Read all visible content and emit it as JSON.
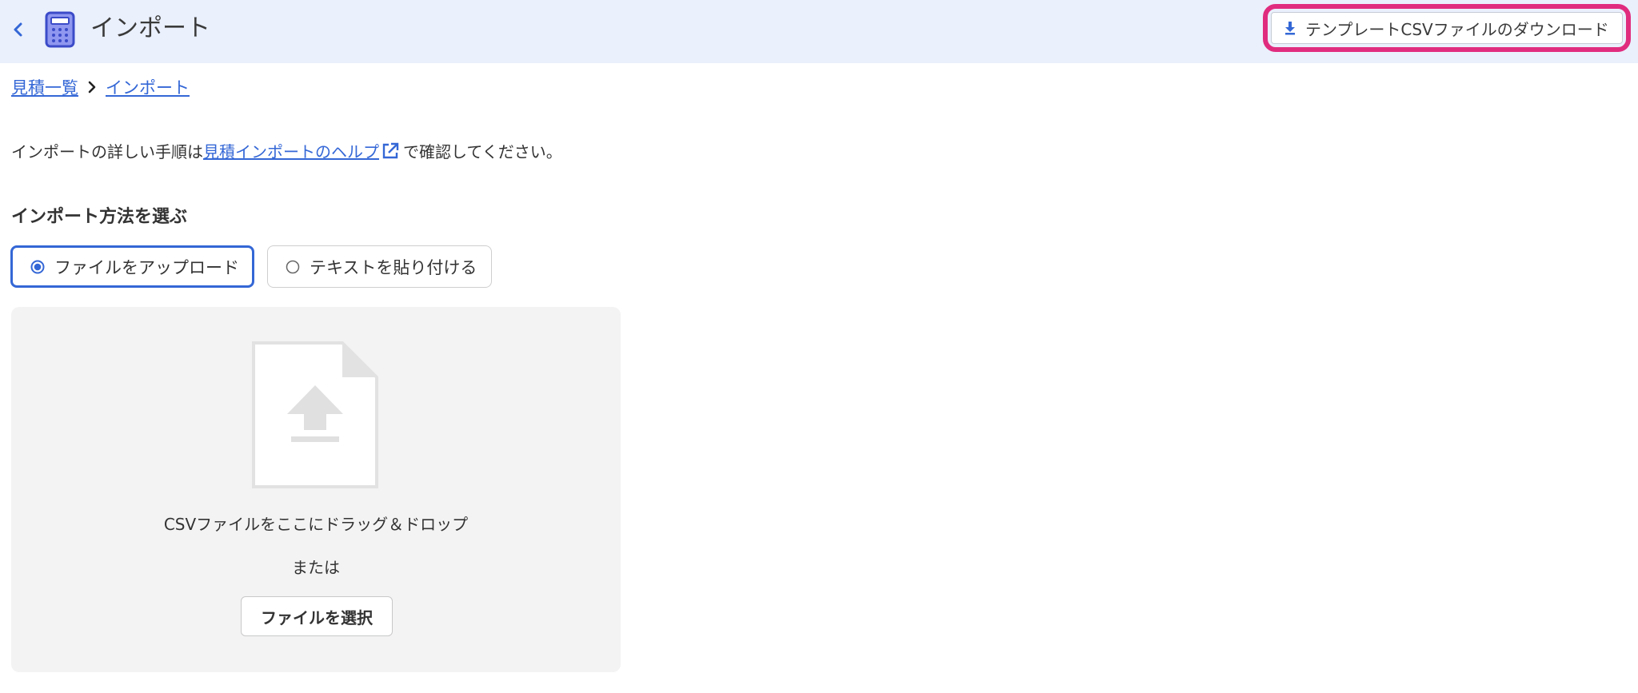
{
  "header": {
    "title": "インポート",
    "back_icon": "chevron-left-icon",
    "app_icon": "calculator-icon",
    "template_button_label": "テンプレートCSVファイルのダウンロード"
  },
  "breadcrumb": {
    "items": [
      "見積一覧",
      "インポート"
    ]
  },
  "help": {
    "prefix": "インポートの詳しい手順は",
    "link_label": "見積インポートのヘルプ",
    "suffix": "で確認してください。"
  },
  "import_method": {
    "title": "インポート方法を選ぶ",
    "options": [
      {
        "label": "ファイルをアップロード",
        "selected": true
      },
      {
        "label": "テキストを貼り付ける",
        "selected": false
      }
    ]
  },
  "dropzone": {
    "instruction": "CSVファイルをここにドラッグ＆ドロップ",
    "or_text": "または",
    "choose_button_label": "ファイルを選択"
  },
  "colors": {
    "header_bg": "#eaf0fc",
    "accent": "#3467d6",
    "highlight": "#e02c7f"
  }
}
